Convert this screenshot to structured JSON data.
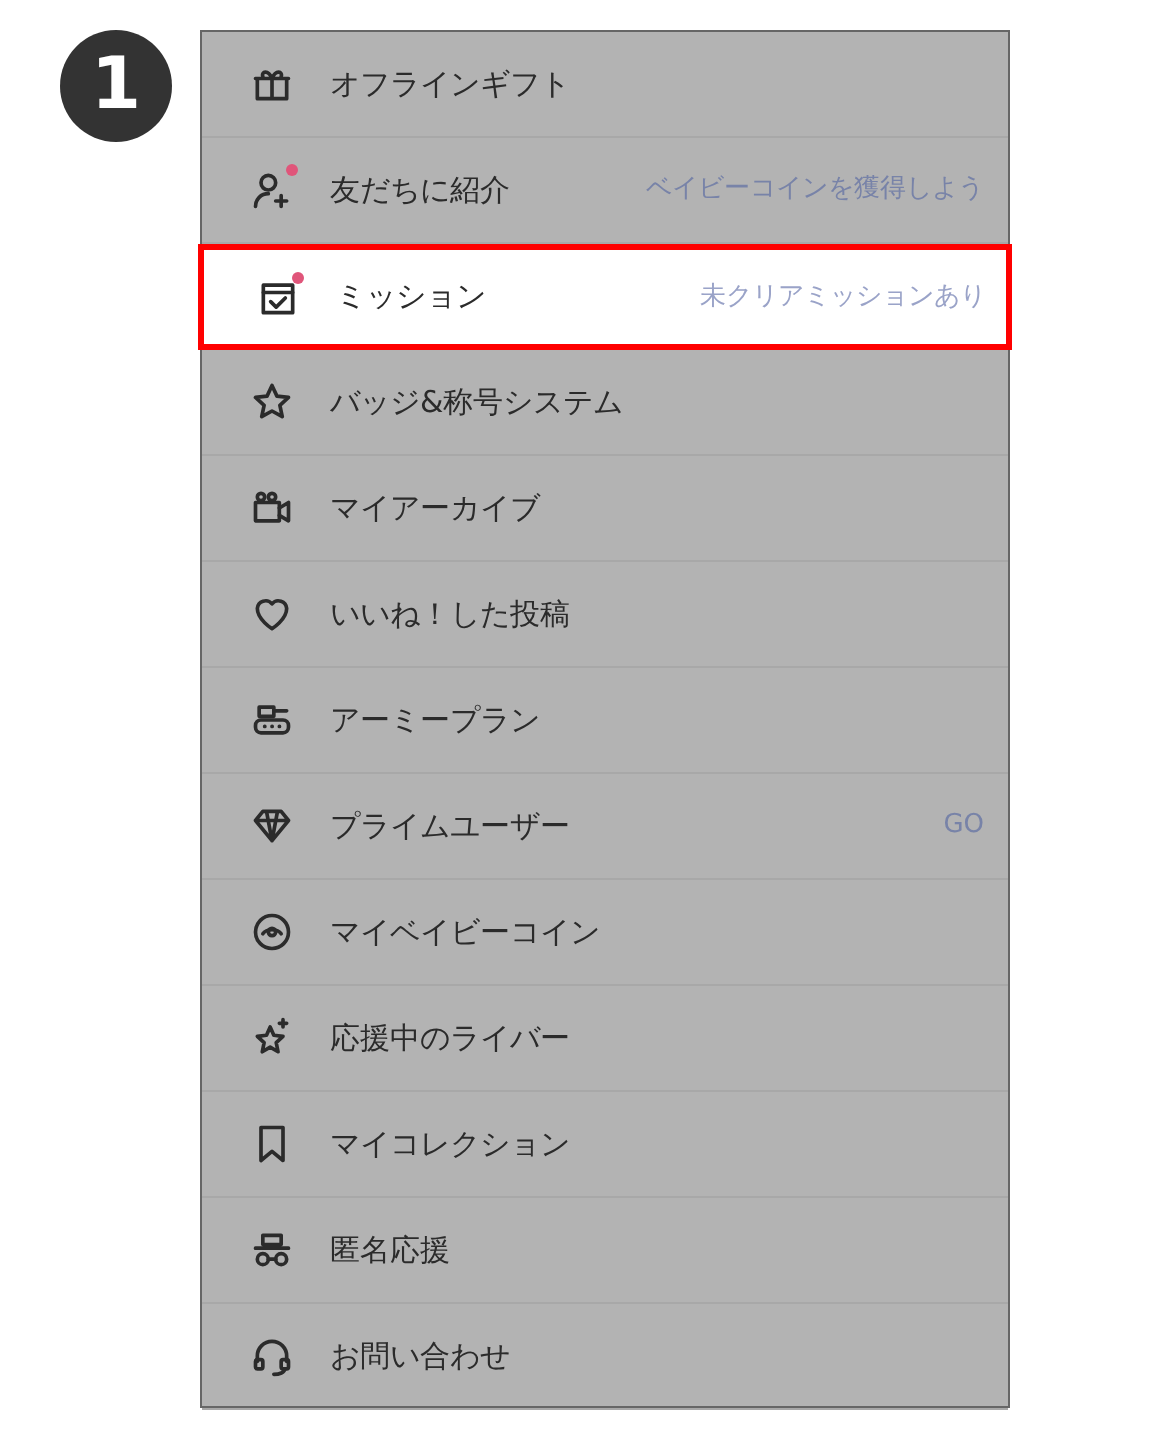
{
  "step_badge": "1",
  "menu": [
    {
      "label": "オフラインギフト",
      "dot": false,
      "highlighted": false
    },
    {
      "label": "友だちに紹介",
      "hint": "ベイビーコインを獲得しよう",
      "dot": true,
      "highlighted": false
    },
    {
      "label": "ミッション",
      "hint": "未クリアミッションあり",
      "dot": true,
      "highlighted": true
    },
    {
      "label": "バッジ&称号システム",
      "dot": false,
      "highlighted": false
    },
    {
      "label": "マイアーカイブ",
      "dot": false,
      "highlighted": false
    },
    {
      "label": "いいね！した投稿",
      "dot": false,
      "highlighted": false
    },
    {
      "label": "アーミープラン",
      "dot": false,
      "highlighted": false
    },
    {
      "label": "プライムユーザー",
      "hint": "GO",
      "dot": false,
      "highlighted": false
    },
    {
      "label": "マイベイビーコイン",
      "dot": false,
      "highlighted": false
    },
    {
      "label": "応援中のライバー",
      "dot": false,
      "highlighted": false
    },
    {
      "label": "マイコレクション",
      "dot": false,
      "highlighted": false
    },
    {
      "label": "匿名応援",
      "dot": false,
      "highlighted": false
    },
    {
      "label": "お問い合わせ",
      "dot": false,
      "highlighted": false
    }
  ]
}
